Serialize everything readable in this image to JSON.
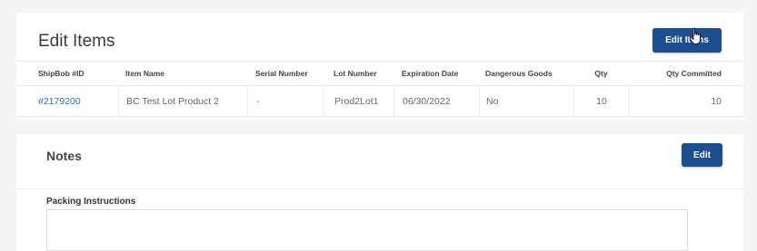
{
  "items_section": {
    "title": "Edit Items",
    "edit_button_label": "Edit Items",
    "columns": [
      "ShipBob #ID",
      "Item Name",
      "Serial Number",
      "Lot Number",
      "Expiration Date",
      "Dangerous Goods",
      "Qty",
      "Qty Committed"
    ],
    "rows": [
      {
        "id": "#2179200",
        "item_name": "BC Test Lot Product 2",
        "serial_number": "-",
        "lot_number": "Prod2Lot1",
        "expiration_date": "06/30/2022",
        "dangerous_goods": "No",
        "qty": "10",
        "qty_committed": "10"
      }
    ]
  },
  "notes_section": {
    "title": "Notes",
    "edit_button_label": "Edit",
    "packing_label": "Packing Instructions",
    "packing_value": ""
  },
  "colors": {
    "primary_button": "#1d4e8f",
    "link": "#2a6db5"
  },
  "icons": {
    "cursor": "hand-pointer-icon"
  }
}
